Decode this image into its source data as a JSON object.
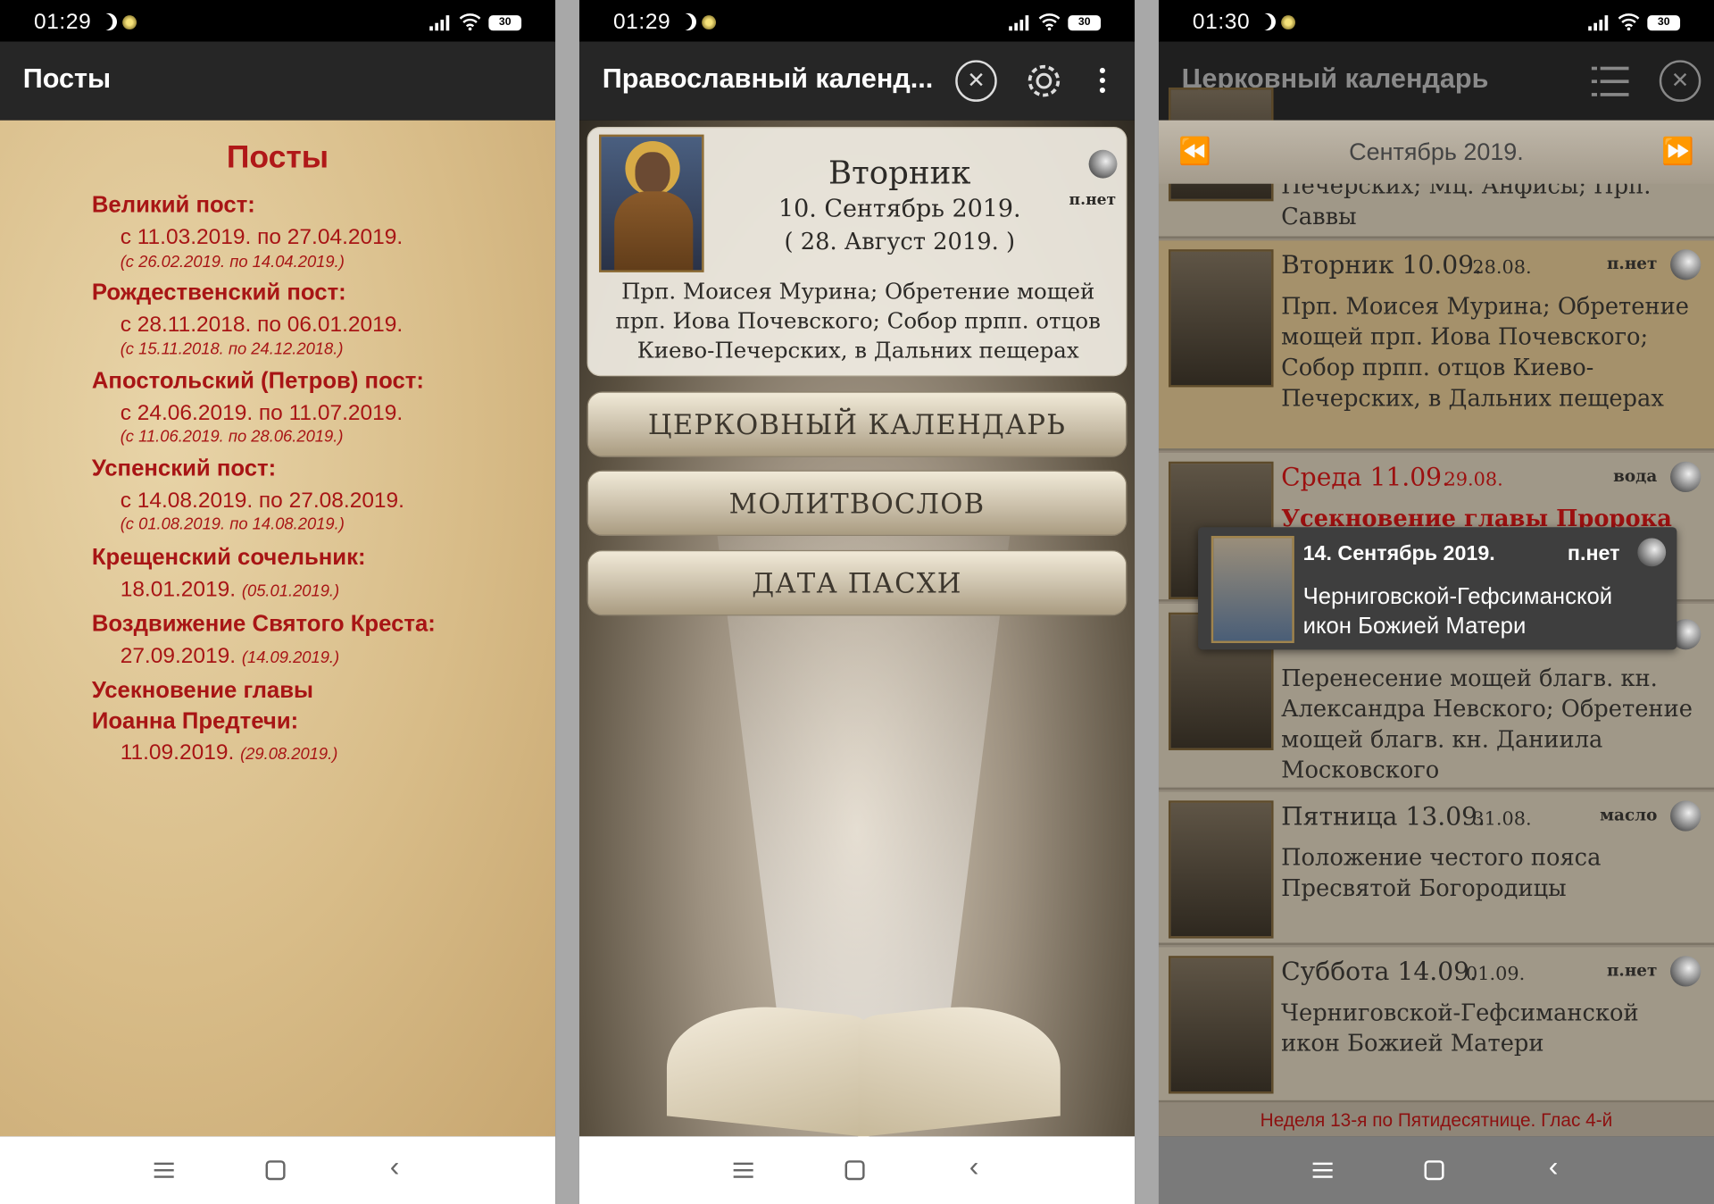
{
  "status": [
    {
      "time": "01:29",
      "battery": "30"
    },
    {
      "time": "01:29",
      "battery": "30"
    },
    {
      "time": "01:30",
      "battery": "30"
    }
  ],
  "screen1": {
    "appbar_title": "Посты",
    "heading": "Посты",
    "fasts": [
      {
        "name": "Великий пост:",
        "dates": "с 11.03.2019. по 27.04.2019.",
        "old": "(с 26.02.2019. по 14.04.2019.)"
      },
      {
        "name": "Рождественский пост:",
        "dates": "с 28.11.2018. по 06.01.2019.",
        "old": "(с 15.11.2018. по 24.12.2018.)"
      },
      {
        "name": "Апостольский (Петров) пост:",
        "dates": "с 24.06.2019. по 11.07.2019.",
        "old": "(с 11.06.2019. по 28.06.2019.)"
      },
      {
        "name": "Успенский пост:",
        "dates": "с 14.08.2019. по 27.08.2019.",
        "old": "(с 01.08.2019. по 14.08.2019.)"
      }
    ],
    "feasts": [
      {
        "name": "Крещенский сочельник:",
        "date": "18.01.2019.",
        "old": "(05.01.2019.)"
      },
      {
        "name": "Воздвижение Святого Креста:",
        "date": "27.09.2019.",
        "old": "(14.09.2019.)"
      }
    ],
    "beheading": {
      "line1": "Усекновение главы",
      "line2": "Иоанна Предтечи:",
      "date": "11.09.2019.",
      "old": "(29.08.2019.)"
    }
  },
  "screen2": {
    "appbar_title": "Православный календ...",
    "day_name": "Вторник",
    "date": "10. Сентябрь 2019.",
    "old_date": "( 28. Август 2019. )",
    "fast": "п.нет",
    "saints": "Прп. Моисея Мурина; Обретение мощей прп. Иова Почевского; Собор прпп. отцов Киево-Печерских, в Дальних пещерах",
    "buttons": [
      "ЦЕРКОВНЫЙ КАЛЕНДАРЬ",
      "МОЛИТВОСЛОВ",
      "ДАТА ПАСХИ"
    ]
  },
  "screen3": {
    "appbar_title": "Церковный календарь",
    "month": "Сентябрь 2019.",
    "partial_row_text": "Печерских; Мц. Анфисы; Прп. Саввы",
    "rows": [
      {
        "day": "Вторник 10.09.",
        "old": "28.08.",
        "fast": "п.нет",
        "text": "Прп. Моисея Мурина; Обретение мощей прп. Иова Почевского; Собор прпп. отцов Киево-Печерских, в Дальних пещерах"
      },
      {
        "day": "Среда 11.09.",
        "old": "29.08.",
        "fast": "вода",
        "text": "Усекновение главы Пророка"
      },
      {
        "day": "",
        "old": "",
        "fast": "",
        "text": "Перенесение мощей благв. кн. Александра Невского; Обретение мощей благв. кн. Даниила Московского"
      },
      {
        "day": "Пятница 13.09.",
        "old": "31.08.",
        "fast": "масло",
        "text": "Положение честого пояса Пресвятой Богородицы"
      },
      {
        "day": "Суббота 14.09.",
        "old": "01.09.",
        "fast": "п.нет",
        "text": "Черниговской-Гефсиманской икон Божией Матери"
      }
    ],
    "popup": {
      "date": "14. Сентябрь 2019.",
      "fast": "п.нет",
      "text": "Черниговской-Гефсиманской икон Божией Матери"
    },
    "sunday": "Неделя 13-я по Пятидесятнице. Глас 4-й"
  }
}
